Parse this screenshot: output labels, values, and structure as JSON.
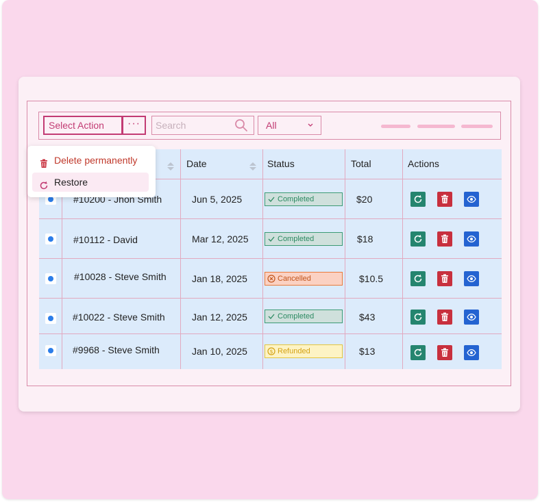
{
  "toolbar": {
    "select_action": "Select Action",
    "more": "···",
    "search_placeholder": "Search",
    "filter_value": "All"
  },
  "dropdown": {
    "delete_label": "Delete permanently",
    "restore_label": "Restore"
  },
  "table": {
    "headers": {
      "date": "Date",
      "status": "Status",
      "total": "Total",
      "actions": "Actions"
    },
    "rows": [
      {
        "order": "#10200 - Jhon Smith",
        "date": "Jun 5, 2025",
        "status": "Completed",
        "total": "$20"
      },
      {
        "order": "#10112 - David",
        "date": "Mar 12, 2025",
        "status": "Completed",
        "total": "$18"
      },
      {
        "order": "#10028 - Steve Smith",
        "date": "Jan 18, 2025",
        "status": "Cancelled",
        "total": "$10.5"
      },
      {
        "order": "#10022 - Steve Smith",
        "date": "Jan 12, 2025",
        "status": "Completed",
        "total": "$43"
      },
      {
        "order": "#9968 - Steve Smith",
        "date": "Jan 10, 2025",
        "status": "Refunded",
        "total": "$13"
      }
    ]
  },
  "icons": {
    "search": "search-icon",
    "chevron": "chevron-down-icon",
    "trash": "trash-icon",
    "restore": "restore-icon",
    "view": "eye-icon",
    "sort": "sort-icon"
  },
  "colors": {
    "accent": "#c23b73",
    "page_bg": "#fad8ec",
    "table_bg": "#dcebfb",
    "completed": "#2c8a62",
    "cancelled": "#c2541a",
    "refunded": "#d4a214",
    "refresh_button": "#25856f",
    "delete_button": "#c8303e",
    "view_button": "#2463d1"
  }
}
